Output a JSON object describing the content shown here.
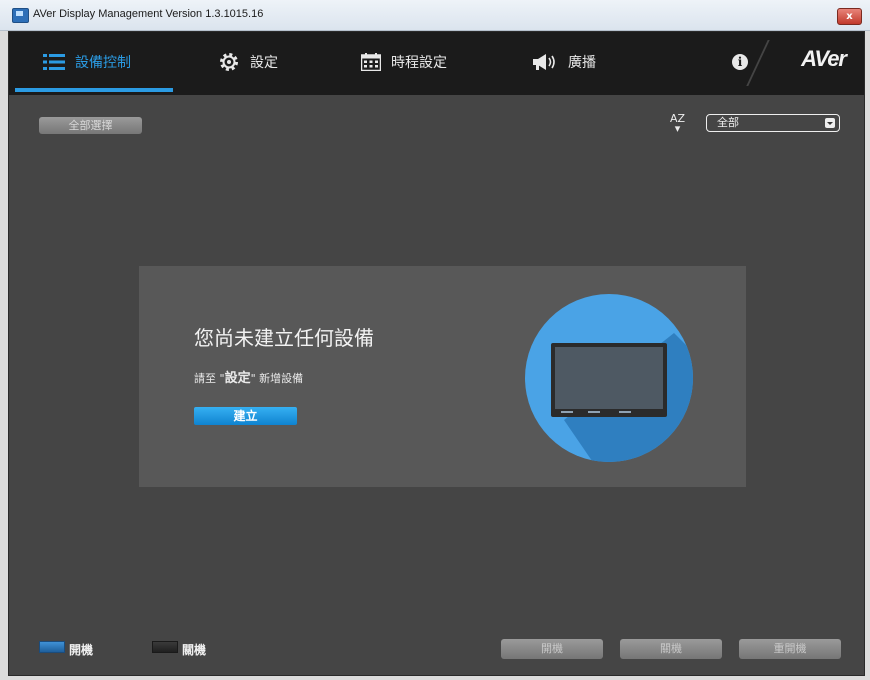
{
  "window": {
    "title": "AVer Display Management Version 1.3.1015.16",
    "close_label": "x"
  },
  "nav": {
    "items": [
      {
        "label": "設備控制",
        "icon": "list-icon",
        "active": true
      },
      {
        "label": "設定",
        "icon": "gear-icon",
        "active": false
      },
      {
        "label": "時程設定",
        "icon": "calendar-icon",
        "active": false
      },
      {
        "label": "廣播",
        "icon": "megaphone-icon",
        "active": false
      }
    ],
    "info_label": "i",
    "logo": "AVer"
  },
  "toolbar": {
    "select_all": "全部選擇",
    "sort_label_top": "AZ",
    "filter_value": "全部"
  },
  "empty_state": {
    "title": "您尚未建立任何設備",
    "hint_prefix": "請至 \"",
    "hint_bold": "設定",
    "hint_suffix": "\" 新增設備",
    "create_label": "建立"
  },
  "legend": {
    "on_label": "開機",
    "off_label": "關機"
  },
  "actions": {
    "power_on": "開機",
    "power_off": "關機",
    "restart": "重開機"
  },
  "colors": {
    "accent": "#2b9be3",
    "on_swatch": "#2a7ec4",
    "off_swatch": "#2c2c2c"
  }
}
